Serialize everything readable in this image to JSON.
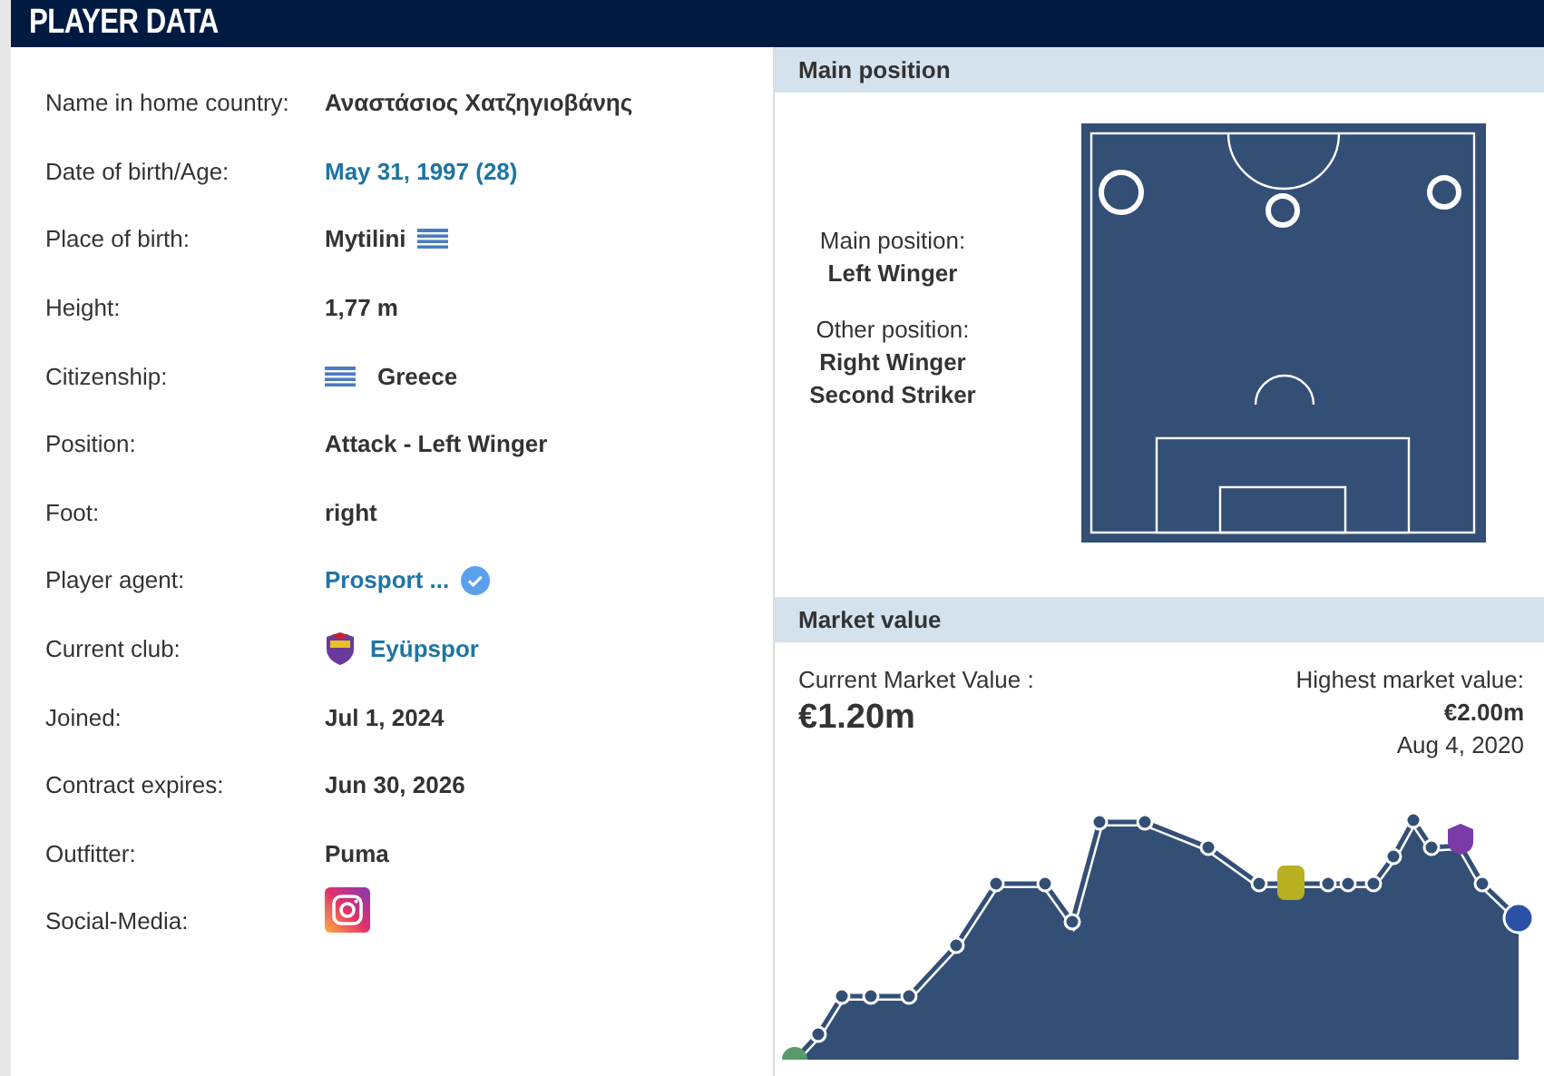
{
  "header": {
    "title": "PLAYER DATA"
  },
  "details": [
    {
      "label": "Name in home country:",
      "value": "Αναστάσιος Χατζηγιοβάνης",
      "kind": "text"
    },
    {
      "label": "Date of birth/Age:",
      "value": "May 31, 1997 (28)",
      "kind": "link"
    },
    {
      "label": "Place of birth:",
      "value": "Mytilini",
      "kind": "flag-after"
    },
    {
      "label": "Height:",
      "value": "1,77 m",
      "kind": "text"
    },
    {
      "label": "Citizenship:",
      "value": "Greece",
      "kind": "flag-before"
    },
    {
      "label": "Position:",
      "value": "Attack - Left Winger",
      "kind": "text"
    },
    {
      "label": "Foot:",
      "value": "right",
      "kind": "text"
    },
    {
      "label": "Player agent:",
      "value": "Prosport ...",
      "kind": "verified-link"
    },
    {
      "label": "Current club:",
      "value": "Eyüpspor",
      "kind": "club-link"
    },
    {
      "label": "Joined:",
      "value": "Jul 1, 2024",
      "kind": "text"
    },
    {
      "label": "Contract expires:",
      "value": "Jun 30, 2026",
      "kind": "text"
    },
    {
      "label": "Outfitter:",
      "value": "Puma",
      "kind": "text"
    },
    {
      "label": "Social-Media:",
      "kind": "social"
    }
  ],
  "main_position": {
    "title": "Main position",
    "main_label": "Main position:",
    "main_value": "Left Winger",
    "other_label": "Other position:",
    "other_values": [
      "Right Winger",
      "Second Striker"
    ]
  },
  "market_value": {
    "title": "Market value",
    "current_label": "Current Market Value :",
    "current_value": "€1.20m",
    "highest_label": "Highest market value:",
    "highest_value": "€2.00m",
    "highest_date": "Aug 4, 2020"
  }
}
